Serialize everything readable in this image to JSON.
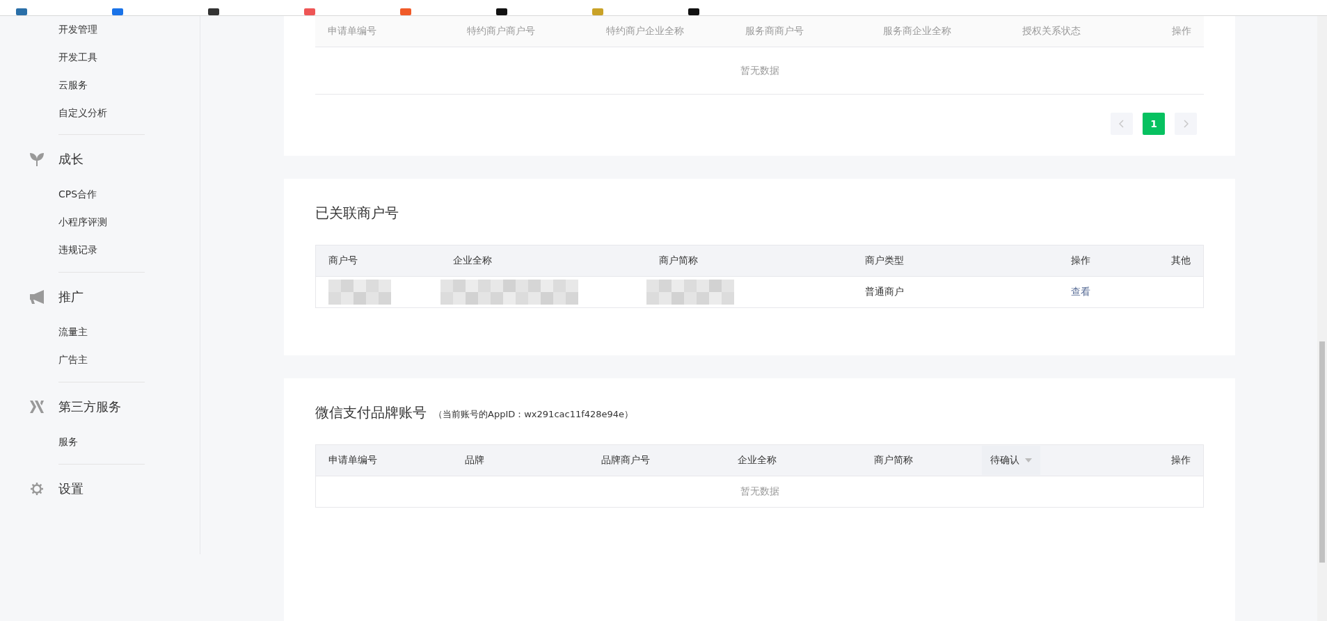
{
  "sidebar": {
    "sections": [
      {
        "items": [
          {
            "label": "开发管理",
            "selected": false
          },
          {
            "label": "开发工具",
            "selected": false
          },
          {
            "label": "云服务",
            "selected": false
          },
          {
            "label": "自定义分析",
            "selected": false
          }
        ]
      },
      {
        "title": "成长",
        "items": [
          {
            "label": "CPS合作",
            "selected": false
          },
          {
            "label": "小程序评测",
            "selected": false
          },
          {
            "label": "违规记录",
            "selected": false
          }
        ]
      },
      {
        "title": "推广",
        "items": [
          {
            "label": "流量主",
            "selected": false
          },
          {
            "label": "广告主",
            "selected": false
          }
        ]
      },
      {
        "title": "第三方服务",
        "items": [
          {
            "label": "服务",
            "selected": false
          }
        ]
      },
      {
        "title": "设置"
      }
    ]
  },
  "authorization_table": {
    "columns": [
      "申请单编号",
      "特约商户商户号",
      "特约商户企业全称",
      "服务商商户号",
      "服务商企业全称",
      "授权关系状态",
      "操作"
    ],
    "empty_text": "暂无数据",
    "pagination": {
      "pages": [
        {
          "label": "1",
          "selected": true
        }
      ]
    }
  },
  "linked_merchants": {
    "title": "已关联商户号",
    "columns": [
      "商户号",
      "企业全称",
      "商户简称",
      "商户类型",
      "操作",
      "其他"
    ],
    "rows": [
      {
        "cells": [
          {
            "kind": "blurred"
          },
          {
            "kind": "blurred"
          },
          {
            "kind": "blurred"
          },
          {
            "kind": "text",
            "text": "普通商户"
          },
          {
            "kind": "link",
            "text": "查看"
          },
          {
            "kind": "empty"
          }
        ]
      }
    ]
  },
  "brand_accounts": {
    "title": "微信支付品牌账号",
    "note": "（当前账号的AppID：wx291cac11f428e94e）",
    "columns": [
      {
        "kind": "text",
        "label": "申请单编号"
      },
      {
        "kind": "text",
        "label": "品牌"
      },
      {
        "kind": "text",
        "label": "品牌商户号"
      },
      {
        "kind": "text",
        "label": "企业全称"
      },
      {
        "kind": "text",
        "label": "商户简称"
      },
      {
        "kind": "filter",
        "label": "待确认"
      },
      {
        "kind": "text",
        "label": "操作"
      }
    ],
    "empty_text": "暂无数据"
  }
}
